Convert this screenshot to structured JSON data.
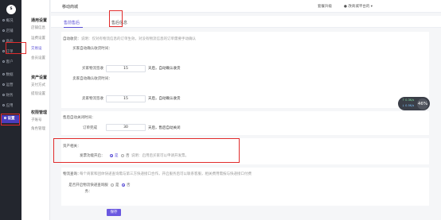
{
  "sidebar": {
    "logo": "S",
    "items": [
      {
        "label": "概况"
      },
      {
        "label": "店铺"
      },
      {
        "label": "商品"
      },
      {
        "label": "订单"
      },
      {
        "label": "客户"
      },
      {
        "label": "数据"
      },
      {
        "label": "运营"
      },
      {
        "label": "财务"
      },
      {
        "label": "应用"
      },
      {
        "label": "设置"
      }
    ]
  },
  "subnav": {
    "group1": "通用设置",
    "group1_items": [
      "店铺信息",
      "运费设置",
      "交易设",
      "会员设置"
    ],
    "group2": "资产设置",
    "group2_items": [
      "支付方式",
      "提现设置"
    ],
    "group3": "权限管理",
    "group3_items": [
      "子账号",
      "角色管理"
    ]
  },
  "topbar": {
    "shop_name": "移动商城",
    "upgrade": "套餐升级",
    "user": "改商城平台的 ▾"
  },
  "tabs": [
    "售前售后",
    "售后信息"
  ],
  "order": {
    "auto_receive_label": "自动收货：",
    "auto_receive_hint": "说明：仅对有物流信息的订单生效，对没有物流信息的订单需要手动确认",
    "express_time_label": "买家自动确认收货时间：",
    "express_days_label": "买家物流签收",
    "express_days_value": "15",
    "express_unit": "天后，自动确认收货",
    "local_time_label": "卖家自动确认收货时间：",
    "local_days_label": "卖家物流签收",
    "local_days_value": "15",
    "local_unit": "天后，自动确认收货"
  },
  "close": {
    "title": "售后自动关闭时间：",
    "label": "订单完成",
    "value": "30",
    "unit": "天后，售后自动关闭"
  },
  "asset": {
    "title": "资产相关：",
    "invoice_label": "发票功能开启：",
    "option_yes": "是",
    "option_no": "否",
    "option_hint": "说明：启用后买家可以申请开发票。"
  },
  "logistics": {
    "title": "物流查询：",
    "hint": "每个商家和团体快递查询需与第三方快递接口合作，开启服务后可以联系客服，相关费用需按与快递接口付费",
    "enable_label": "是否开启物流快递查询服务：",
    "option_yes": "是",
    "option_no": "否"
  },
  "save_label": "保存",
  "stats": {
    "up": "↑ 0.3K/s",
    "down": "↓ 0.5K/s",
    "percent": "46%"
  }
}
